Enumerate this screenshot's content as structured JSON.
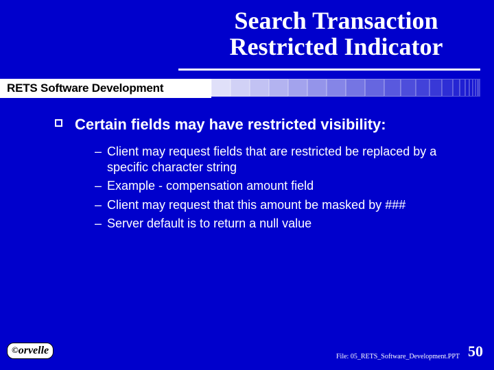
{
  "slide": {
    "title_line1": "Search Transaction",
    "title_line2": "Restricted Indicator",
    "ribbon_label": "RETS Software Development",
    "main_bullet": "Certain fields may have restricted visibility:",
    "subs": [
      "Client may request fields that are restricted be replaced by a specific character string",
      "Example - compensation amount field",
      "Client may request that this amount be masked by ###",
      "Server default is to return a null value"
    ],
    "logo_text": "orvelle",
    "file_label": "File: 05_RETS_Software_Development.PPT",
    "page_number": "50"
  }
}
